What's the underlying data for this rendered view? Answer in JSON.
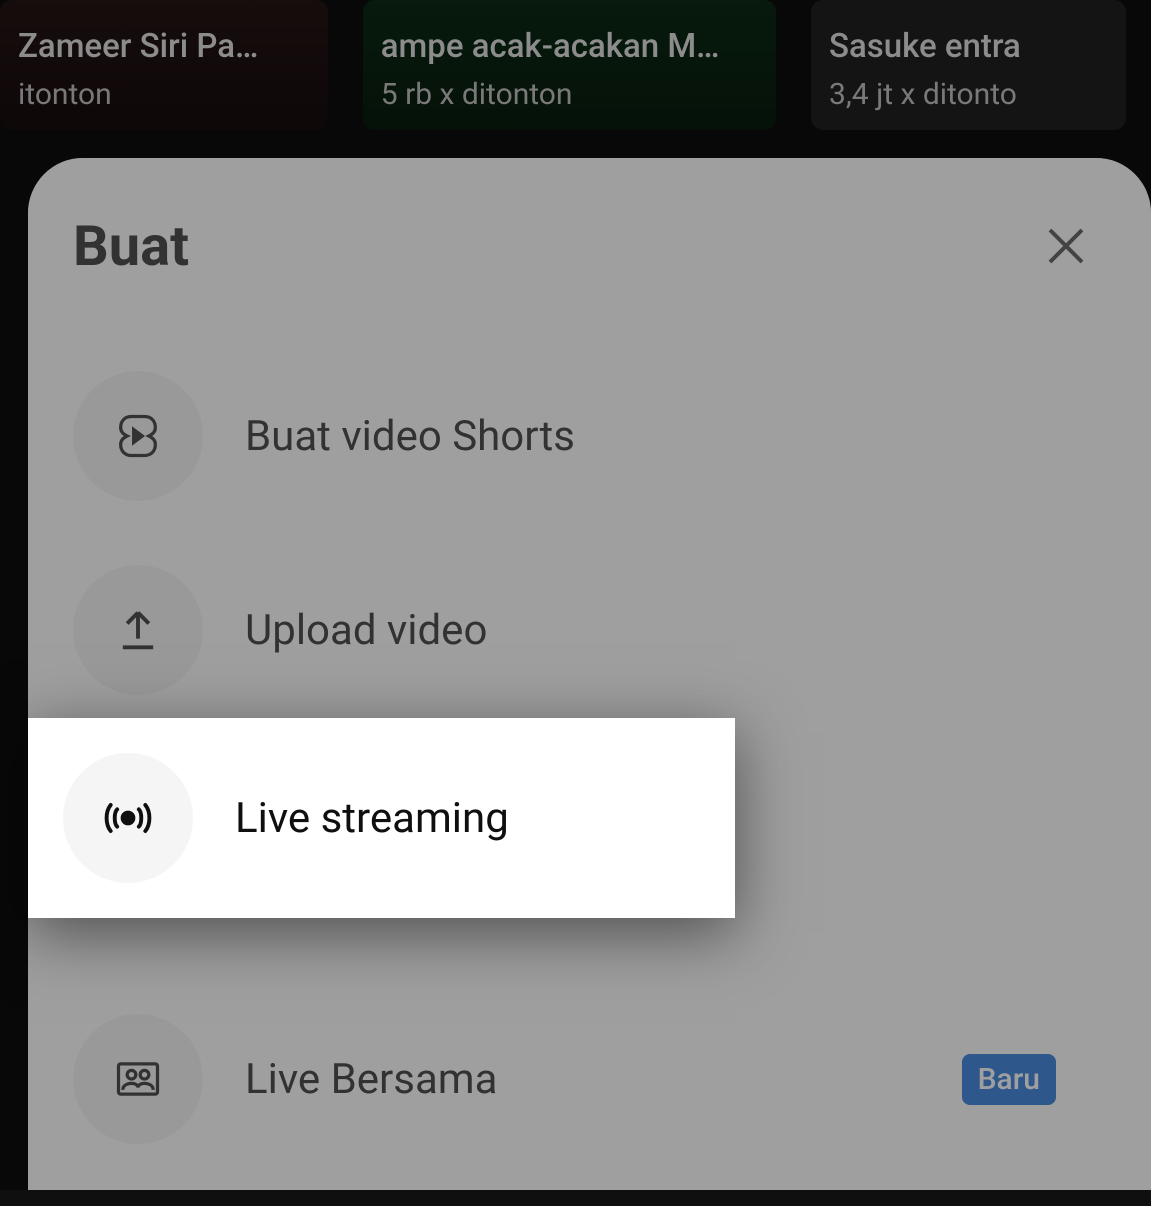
{
  "background_videos": [
    {
      "title": "Zameer Siri Pa…",
      "views": "itonton"
    },
    {
      "title": "ampe acak-acakan M…",
      "views": "5 rb x ditonton"
    },
    {
      "title": "Sasuke entra",
      "views": "3,4 jt x ditonto"
    }
  ],
  "sheet": {
    "title": "Buat",
    "items": [
      {
        "label": "Buat video Shorts",
        "icon": "shorts",
        "badge": null
      },
      {
        "label": "Upload video",
        "icon": "upload",
        "badge": null
      },
      {
        "label": "Live streaming",
        "icon": "live",
        "badge": null,
        "highlighted": true
      },
      {
        "label": "Live Bersama",
        "icon": "live-together",
        "badge": "Baru"
      }
    ]
  }
}
